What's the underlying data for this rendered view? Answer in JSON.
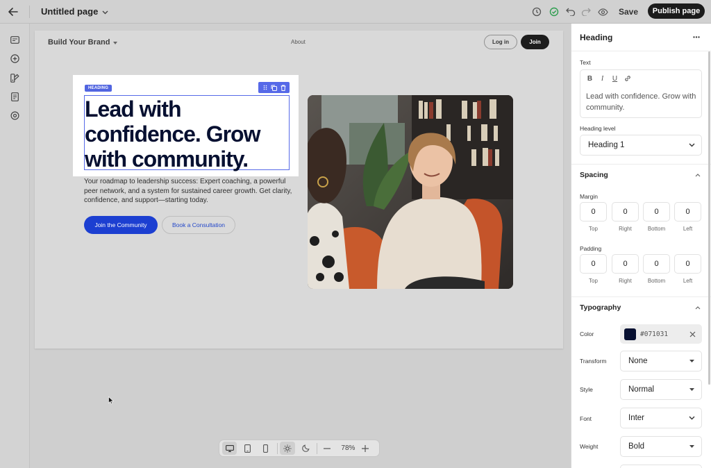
{
  "topbar": {
    "page_title": "Untitled page",
    "save_label": "Save",
    "publish_label": "Publish page"
  },
  "site": {
    "brand": "Build Your Brand",
    "nav_about": "About",
    "login_label": "Log in",
    "join_label": "Join",
    "heading_tag": "HEADING",
    "heading": "Lead with confidence. Grow with community.",
    "subcopy": "Your roadmap to leadership success: Expert coaching, a powerful peer network, and a system for sustained career growth. Get clarity, confidence, and support—starting today.",
    "primary_cta": "Join the Community",
    "secondary_cta": "Book a Consultation"
  },
  "bottombar": {
    "zoom": "78%"
  },
  "panel": {
    "title": "Heading",
    "text_label": "Text",
    "text_value": "Lead with confidence. Grow with community.",
    "editor_tools": [
      "B",
      "I",
      "U"
    ],
    "heading_level_label": "Heading level",
    "heading_level_value": "Heading 1",
    "spacing_title": "Spacing",
    "margin_label": "Margin",
    "padding_label": "Padding",
    "margin": [
      {
        "value": "0",
        "caption": "Top"
      },
      {
        "value": "0",
        "caption": "Right"
      },
      {
        "value": "0",
        "caption": "Bottom"
      },
      {
        "value": "0",
        "caption": "Left"
      }
    ],
    "padding": [
      {
        "value": "0",
        "caption": "Top"
      },
      {
        "value": "0",
        "caption": "Right"
      },
      {
        "value": "0",
        "caption": "Bottom"
      },
      {
        "value": "0",
        "caption": "Left"
      }
    ],
    "typography_title": "Typography",
    "color_label": "Color",
    "color_hex": "#071031",
    "transform_label": "Transform",
    "transform_value": "None",
    "style_label": "Style",
    "style_value": "Normal",
    "font_label": "Font",
    "font_value": "Inter",
    "weight_label": "Weight",
    "weight_value": "Bold"
  },
  "colors": {
    "accent_blue": "#1c3fd1",
    "selection_blue": "#5669e8",
    "heading_color": "#071031",
    "publish_bg": "#1b1b1b",
    "status_green": "#2e9e4f"
  },
  "icons": [
    "back-arrow-icon",
    "chevron-down-icon",
    "history-icon",
    "check-circle-icon",
    "undo-icon",
    "redo-icon",
    "eye-icon",
    "more-icon",
    "desktop-icon",
    "tablet-icon",
    "mobile-icon",
    "sun-icon",
    "moon-icon",
    "minus-icon",
    "plus-icon"
  ]
}
